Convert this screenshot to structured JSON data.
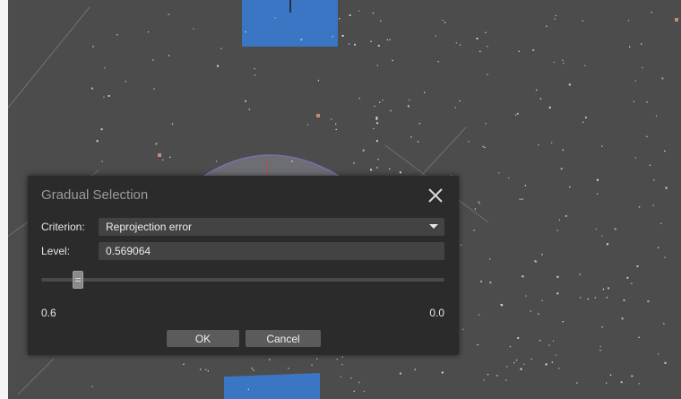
{
  "dialog": {
    "title": "Gradual Selection",
    "criterion_label": "Criterion:",
    "criterion_value": "Reprojection error",
    "level_label": "Level:",
    "level_value": "0.569064",
    "slider": {
      "min_label": "0.6",
      "max_label": "0.0",
      "position_fraction": 0.09
    },
    "ok_label": "OK",
    "cancel_label": "Cancel",
    "close_icon": "close-icon"
  },
  "colors": {
    "viewport_bg": "#4c4c4c",
    "camera_blue": "#3a76c4",
    "dialog_bg": "#2b2b2b",
    "field_bg": "#434343",
    "button_bg": "#5b5b5b"
  }
}
